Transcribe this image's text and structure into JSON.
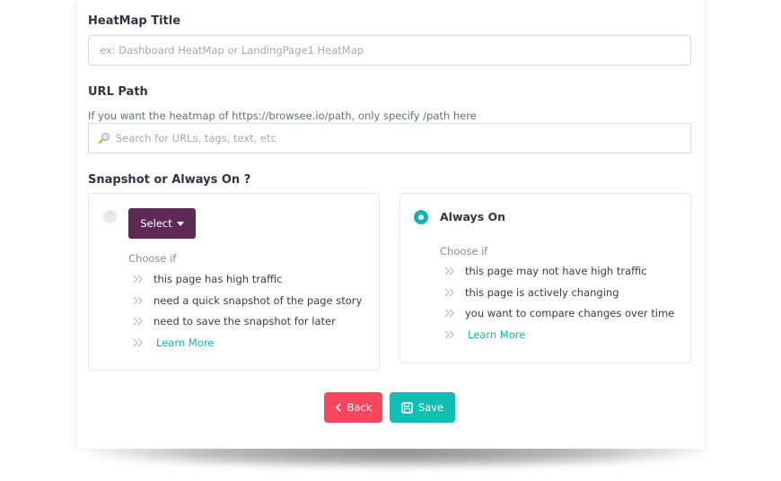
{
  "form": {
    "title_label": "HeatMap Title",
    "title_placeholder": "ex: Dashboard HeatMap or LandingPage1 HeatMap",
    "url_label": "URL Path",
    "url_hint": "If you want the heatmap of https://browsee.io/path, only specify /path here",
    "url_placeholder": "Search for URLs, tags, text, etc",
    "mode_label": "Snapshot or Always On ?"
  },
  "options": {
    "snapshot": {
      "selected": false,
      "select_label": "Select",
      "choose_if": "Choose if",
      "items": [
        "this page has high traffic",
        "need a quick snapshot of the page story",
        "need to save the snapshot for later"
      ],
      "learn_more": "Learn More"
    },
    "always_on": {
      "selected": true,
      "title": "Always On",
      "choose_if": "Choose if",
      "items": [
        "this page may not have high traffic",
        "this page is actively changing",
        "you want to compare changes over time"
      ],
      "learn_more": "Learn More"
    }
  },
  "actions": {
    "back_label": "Back",
    "save_label": "Save"
  },
  "colors": {
    "accent": "#12b5ad",
    "back": "#f8465c",
    "select": "#5e2a55"
  },
  "icons": {
    "search": "magnifier-icon",
    "bullet": "double-chevron-right-icon",
    "back": "chevron-left-icon",
    "save": "floppy-disk-icon",
    "select": "caret-down-icon"
  }
}
